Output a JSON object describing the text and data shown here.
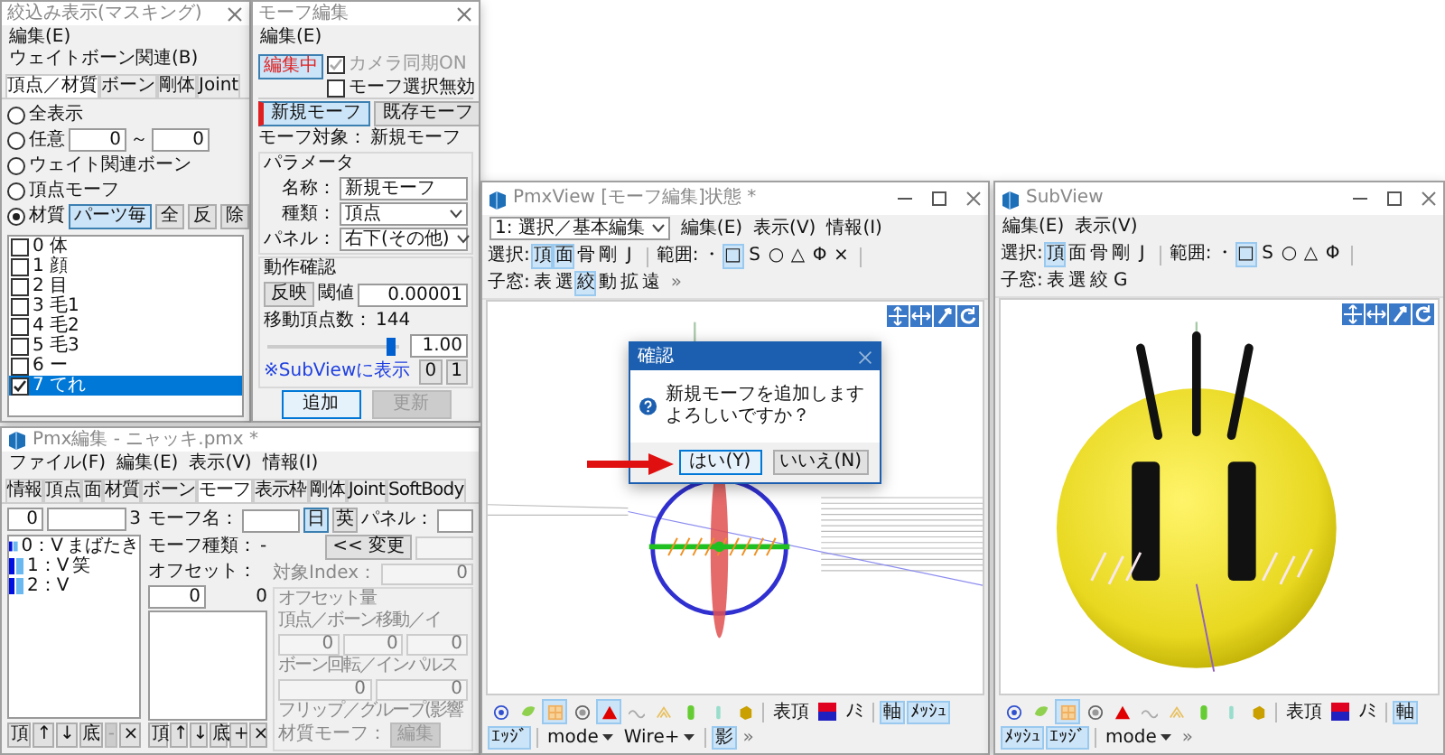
{
  "masking_window": {
    "title": "絞込み表示(マスキング)",
    "menu": [
      "編集(E)",
      "ウェイトボーン関連(B)"
    ],
    "tabs": [
      {
        "label": "頂点／材質",
        "selected": true
      },
      {
        "label": "ボーン",
        "selected": false
      },
      {
        "label": "剛体",
        "selected": false
      },
      {
        "label": "Joint",
        "selected": false
      }
    ],
    "modes": [
      {
        "label": "全表示",
        "selected": false
      },
      {
        "label": "任意",
        "selected": false
      },
      {
        "label": "ウェイト関連ボーン",
        "selected": false
      },
      {
        "label": "頂点モーフ",
        "selected": false
      },
      {
        "label": "材質",
        "selected": true
      }
    ],
    "range": {
      "from": "0",
      "separator": "～",
      "to": "0"
    },
    "material_buttons": [
      {
        "label": "パーツ毎",
        "selected": true
      },
      {
        "label": "全",
        "selected": false
      },
      {
        "label": "反",
        "selected": false
      },
      {
        "label": "除",
        "selected": false
      }
    ],
    "materials": [
      {
        "label": "0 体",
        "checked": false,
        "selected": false
      },
      {
        "label": "1 顔",
        "checked": false,
        "selected": false
      },
      {
        "label": "2 目",
        "checked": false,
        "selected": false
      },
      {
        "label": "3 毛1",
        "checked": false,
        "selected": false
      },
      {
        "label": "4 毛2",
        "checked": false,
        "selected": false
      },
      {
        "label": "5 毛3",
        "checked": false,
        "selected": false
      },
      {
        "label": "6 ー",
        "checked": false,
        "selected": false
      },
      {
        "label": "7 てれ",
        "checked": true,
        "selected": true
      }
    ]
  },
  "morph_window": {
    "title": "モーフ編集",
    "menu": [
      "編集(E)"
    ],
    "edit_toggle": {
      "label": "編集中",
      "on": true
    },
    "options": [
      {
        "label": "カメラ同期ON",
        "checked": true,
        "disabled": true
      },
      {
        "label": "モーフ選択無効",
        "checked": false,
        "disabled": false
      }
    ],
    "mode_tabs": [
      {
        "label": "新規モーフ",
        "selected": true
      },
      {
        "label": "既存モーフ",
        "selected": false
      }
    ],
    "target_label": "モーフ対象：",
    "target_value": "新規モーフ",
    "params_title": "パラメータ",
    "name_label": "名称：",
    "name_value": "新規モーフ",
    "type_label": "種類：",
    "type_value": "頂点",
    "panel_label": "パネル：",
    "panel_value": "右下(その他)",
    "check_title": "動作確認",
    "apply_button": "反映",
    "threshold_label": "閾値",
    "threshold_value": "0.00001",
    "moved_label": "移動頂点数：",
    "moved_value": "144",
    "slider": {
      "level": 0.95
    },
    "slider_value": "1.00",
    "preset_buttons": [
      "0",
      "1"
    ],
    "subview_link": "※SubViewに表示",
    "add_button": {
      "label": "追加",
      "disabled": false
    },
    "update_button": {
      "label": "更新",
      "disabled": true
    }
  },
  "pmx_window": {
    "title": "Pmx編集 - ニャッキ.pmx *",
    "menu": [
      "ファイル(F)",
      "編集(E)",
      "表示(V)",
      "情報(I)"
    ],
    "tabs": [
      {
        "label": "情報",
        "selected": false
      },
      {
        "label": "頂点",
        "selected": false
      },
      {
        "label": "面",
        "selected": false
      },
      {
        "label": "材質",
        "selected": false
      },
      {
        "label": "ボーン",
        "selected": false
      },
      {
        "label": "モーフ",
        "selected": true
      },
      {
        "label": "表示枠",
        "selected": false
      },
      {
        "label": "剛体",
        "selected": false
      },
      {
        "label": "Joint",
        "selected": false
      },
      {
        "label": "SoftBody",
        "selected": false
      }
    ],
    "list_index": "0",
    "list_count": "3",
    "morphs": [
      {
        "label": "0：V",
        "name": "まばたき"
      },
      {
        "label": "1：V",
        "name": "笑"
      },
      {
        "label": "2：V"
      }
    ],
    "list_buttons": [
      {
        "label": "頂",
        "disabled": false
      },
      {
        "label": "↑",
        "disabled": false
      },
      {
        "label": "↓",
        "disabled": false
      },
      {
        "label": "底",
        "disabled": false
      },
      {
        "label": "-",
        "disabled": true
      },
      {
        "label": "×",
        "disabled": false
      }
    ],
    "morph_name_label": "モーフ名：",
    "languages": [
      {
        "label": "日",
        "selected": true
      },
      {
        "label": "英",
        "selected": false
      }
    ],
    "panel_label": "パネル：",
    "type_label": "モーフ種類：",
    "type_value": "-",
    "change_button": "<< 変更",
    "offset_label": "オフセット：",
    "offset_index": "0",
    "offset_count": "0",
    "target_index_label": "対象Index：",
    "target_index_value": "0",
    "offset_group": {
      "title": "オフセット量",
      "move_label": "頂点／ボーン移動／イ",
      "move_values": [
        "0",
        "0",
        "0"
      ],
      "rotate_label": "ボーン回転／インパルス",
      "rotate_values": [
        "0",
        "0"
      ],
      "flip_label": "フリップ／グループ(影響",
      "material_label": "材質モーフ：",
      "material_button": "編集"
    },
    "offset_buttons": [
      {
        "label": "頂",
        "disabled": false
      },
      {
        "label": "↑",
        "disabled": false
      },
      {
        "label": "↓",
        "disabled": false
      },
      {
        "label": "底",
        "disabled": false
      },
      {
        "label": "+",
        "disabled": false
      },
      {
        "label": "×",
        "disabled": false
      }
    ]
  },
  "pmx_view": {
    "title": "PmxView [モーフ編集]状態 *",
    "mode_select": "1: 選択／基本編集",
    "menu": [
      "編集(E)",
      "表示(V)",
      "情報(I)"
    ],
    "toolbar": [
      {
        "label": "選択:",
        "items": [
          {
            "label": "頂",
            "selected": true
          },
          {
            "label": "面",
            "selected": true
          },
          {
            "label": "骨",
            "selected": false
          },
          {
            "label": "剛",
            "selected": false
          },
          {
            "label": "J",
            "selected": false
          }
        ]
      },
      {
        "label": "範囲:",
        "items": [
          {
            "label": "・",
            "selected": false
          },
          {
            "label": "□",
            "selected": true
          },
          {
            "label": "S",
            "selected": false
          },
          {
            "label": "○",
            "selected": false
          },
          {
            "label": "△",
            "selected": false
          },
          {
            "label": "Φ",
            "selected": false
          },
          {
            "label": "×",
            "selected": false
          }
        ]
      },
      {
        "label": "子窓:",
        "items": [
          {
            "label": "表",
            "selected": false
          },
          {
            "label": "選",
            "selected": false
          },
          {
            "label": "絞",
            "selected": true
          },
          {
            "label": "動",
            "selected": false
          },
          {
            "label": "拡",
            "selected": false
          },
          {
            "label": "遠",
            "selected": false
          }
        ]
      }
    ],
    "toolbar_more": "»",
    "dialog": {
      "title": "確認",
      "message": "新規モーフを追加しますよろしいですか？",
      "buttons": [
        {
          "label": "はい(Y)",
          "selected": true
        },
        {
          "label": "いいえ(N)",
          "selected": false
        }
      ]
    },
    "bottom_toolbar": [
      {
        "kind": "icon",
        "selected": false
      },
      {
        "kind": "icon",
        "selected": false
      },
      {
        "kind": "icon",
        "selected": true
      },
      {
        "kind": "icon",
        "selected": false
      },
      {
        "kind": "icon",
        "selected": true
      },
      {
        "kind": "icon",
        "selected": false
      },
      {
        "kind": "icon",
        "selected": false
      },
      {
        "kind": "icon",
        "selected": false
      },
      {
        "kind": "icon",
        "selected": false
      },
      {
        "kind": "icon",
        "selected": false
      },
      {
        "kind": "separator"
      },
      {
        "kind": "text",
        "label": "表頂",
        "selected": false
      },
      {
        "kind": "swatch",
        "selected": false
      },
      {
        "kind": "text",
        "label": "ﾉﾐ",
        "selected": false
      },
      {
        "kind": "separator"
      },
      {
        "kind": "text",
        "label": "軸",
        "selected": true
      },
      {
        "kind": "text",
        "label": "ﾒｯｼｭ",
        "selected": true
      },
      {
        "kind": "text",
        "label": "ｴｯｼﾞ",
        "selected": true
      },
      {
        "kind": "separator"
      },
      {
        "kind": "dropdown",
        "label": "mode"
      },
      {
        "kind": "dropdown",
        "label": "Wire+"
      },
      {
        "kind": "separator"
      },
      {
        "kind": "text",
        "label": "影",
        "selected": true
      }
    ],
    "bottom_more": "»"
  },
  "sub_view": {
    "title": "SubView",
    "menu": [
      "編集(E)",
      "表示(V)"
    ],
    "toolbar": [
      {
        "label": "選択:",
        "items": [
          {
            "label": "頂",
            "selected": true
          },
          {
            "label": "面",
            "selected": false
          },
          {
            "label": "骨",
            "selected": false
          },
          {
            "label": "剛",
            "selected": false
          },
          {
            "label": "J",
            "selected": false
          }
        ]
      },
      {
        "label": "範囲:",
        "items": [
          {
            "label": "・",
            "selected": false
          },
          {
            "label": "□",
            "selected": true
          },
          {
            "label": "S",
            "selected": false
          },
          {
            "label": "○",
            "selected": false
          },
          {
            "label": "△",
            "selected": false
          },
          {
            "label": "Φ",
            "selected": false
          }
        ]
      },
      {
        "label": "子窓:",
        "items": [
          {
            "label": "表",
            "selected": false
          },
          {
            "label": "選",
            "selected": false
          },
          {
            "label": "絞",
            "selected": false
          },
          {
            "label": "G",
            "selected": false
          }
        ]
      }
    ],
    "bottom_toolbar": [
      {
        "kind": "icon",
        "selected": false
      },
      {
        "kind": "icon",
        "selected": false
      },
      {
        "kind": "icon",
        "selected": true
      },
      {
        "kind": "icon",
        "selected": false
      },
      {
        "kind": "icon",
        "selected": false
      },
      {
        "kind": "icon",
        "selected": false
      },
      {
        "kind": "icon",
        "selected": false
      },
      {
        "kind": "icon",
        "selected": false
      },
      {
        "kind": "icon",
        "selected": false
      },
      {
        "kind": "icon",
        "selected": false
      },
      {
        "kind": "separator"
      },
      {
        "kind": "text",
        "label": "表頂",
        "selected": false
      },
      {
        "kind": "swatch",
        "selected": false
      },
      {
        "kind": "text",
        "label": "ﾉﾐ",
        "selected": false
      },
      {
        "kind": "separator"
      },
      {
        "kind": "text",
        "label": "軸",
        "selected": true
      },
      {
        "kind": "text",
        "label": "ﾒｯｼｭ",
        "selected": true
      },
      {
        "kind": "text",
        "label": "ｴｯｼﾞ",
        "selected": true
      },
      {
        "kind": "separator"
      },
      {
        "kind": "dropdown",
        "label": "mode"
      }
    ],
    "bottom_more": "»"
  }
}
